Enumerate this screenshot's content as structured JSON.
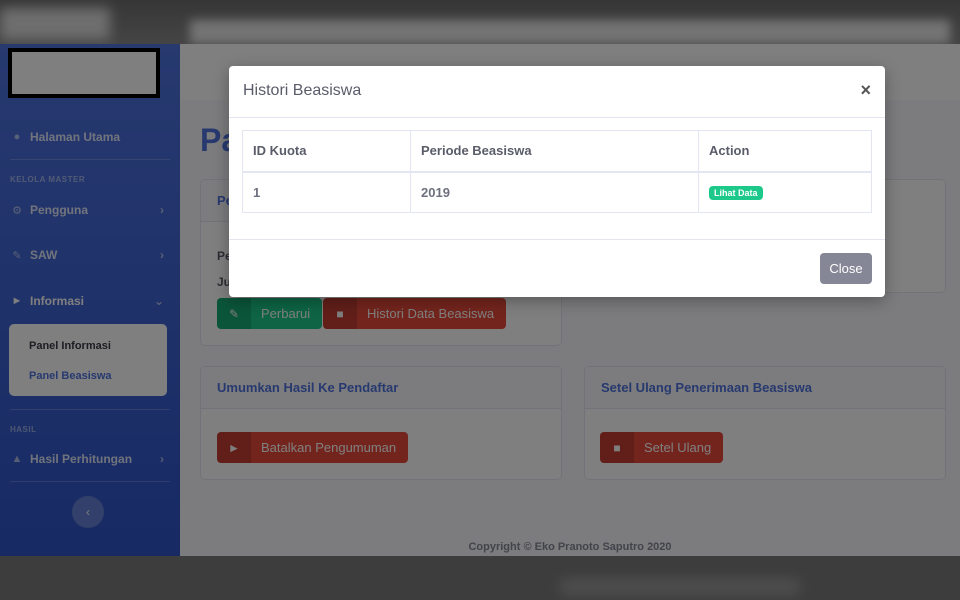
{
  "sidebar": {
    "items": [
      {
        "label": "Halaman Utama",
        "icon": "tachometer-icon"
      },
      {
        "label": "Pengguna",
        "icon": "gear-icon"
      },
      {
        "label": "SAW",
        "icon": "pencil-icon"
      },
      {
        "label": "Informasi",
        "icon": "bullhorn-icon"
      },
      {
        "label": "Hasil Perhitungan",
        "icon": "chart-area-icon"
      }
    ],
    "headings": [
      "KELOLA MASTER",
      "HASIL"
    ],
    "subitems": [
      "Panel Informasi",
      "Panel Beasiswa"
    ],
    "toggle_icon": "chevron-left-icon"
  },
  "main": {
    "page_heading": "Pa",
    "card1": {
      "header": "Pe",
      "text_line1": "Pe",
      "text_line2": "Ju",
      "btn_update": "Perbarui",
      "btn_history": "Histori Data Beasiswa"
    },
    "card2": {
      "header": "Umumkan Hasil Ke Pendaftar",
      "btn": "Batalkan Pengumuman"
    },
    "card3": {
      "header": "Setel Ulang Penerimaan Beasiswa",
      "btn": "Setel Ulang"
    },
    "copyright": "Copyright © Eko Pranoto Saputro 2020"
  },
  "modal": {
    "title": "Histori Beasiswa",
    "close_x": "×",
    "table": {
      "headers": [
        "ID Kuota",
        "Periode Beasiswa",
        "Action"
      ],
      "rows": [
        {
          "id": "1",
          "periode": "2019",
          "action": "Lihat Data"
        }
      ]
    },
    "close_button": "Close"
  },
  "colors": {
    "primary": "#4e73df",
    "success": "#1cc88a",
    "danger": "#e74a3b",
    "secondary": "#858796"
  }
}
